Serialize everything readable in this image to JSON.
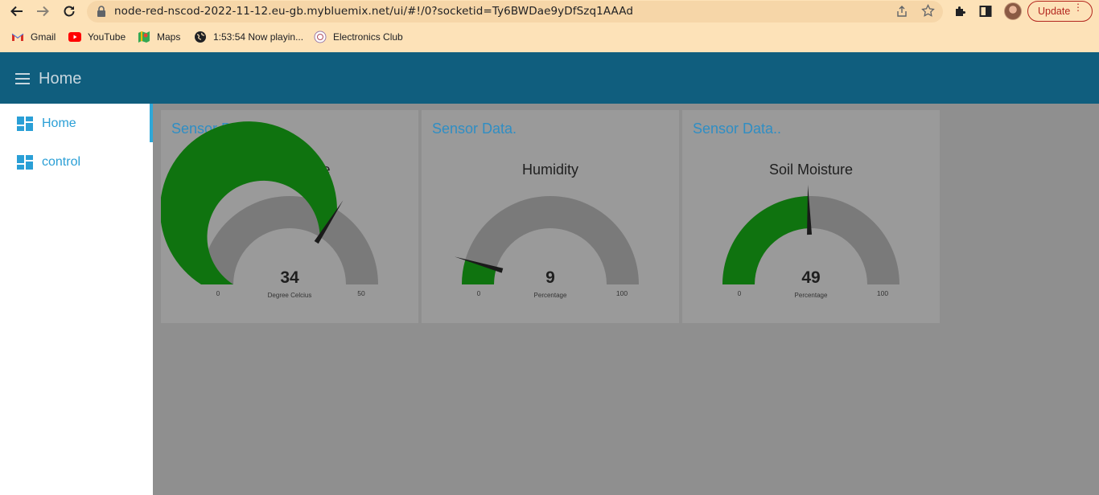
{
  "browser": {
    "url": "node-red-nscod-2022-11-12.eu-gb.mybluemix.net/ui/#!/0?socketid=Ty6BWDae9yDfSzq1AAAd",
    "update_label": "Update",
    "bookmarks": [
      {
        "label": "Gmail",
        "icon": "gmail-icon"
      },
      {
        "label": "YouTube",
        "icon": "youtube-icon"
      },
      {
        "label": "Maps",
        "icon": "maps-icon"
      },
      {
        "label": "1:53:54 Now playin...",
        "icon": "globe-icon"
      },
      {
        "label": "Electronics Club",
        "icon": "club-icon"
      }
    ]
  },
  "app": {
    "title": "Home"
  },
  "sidebar": {
    "items": [
      {
        "label": "Home",
        "active": true
      },
      {
        "label": "control",
        "active": false
      }
    ]
  },
  "cards": [
    {
      "title": "Sensor Data",
      "gauge_title": "Temparature",
      "value_label": "34",
      "unit": "Degree Celcius",
      "min_label": "0",
      "max_label": "50"
    },
    {
      "title": "Sensor Data.",
      "gauge_title": "Humidity",
      "value_label": "9",
      "unit": "Percentage",
      "min_label": "0",
      "max_label": "100"
    },
    {
      "title": "Sensor Data..",
      "gauge_title": "Soil Moisture",
      "value_label": "49",
      "unit": "Percentage",
      "min_label": "0",
      "max_label": "100"
    }
  ],
  "gauges": [
    {
      "value": 34,
      "min": 0,
      "max": 50
    },
    {
      "value": 9,
      "min": 0,
      "max": 100
    },
    {
      "value": 49,
      "min": 0,
      "max": 100
    }
  ],
  "colors": {
    "gauge_fill": "#0f730f",
    "gauge_track": "#7a7a7a",
    "needle": "#1a1a1a",
    "header_bg": "#105e7e",
    "accent": "#2a9fd6"
  }
}
